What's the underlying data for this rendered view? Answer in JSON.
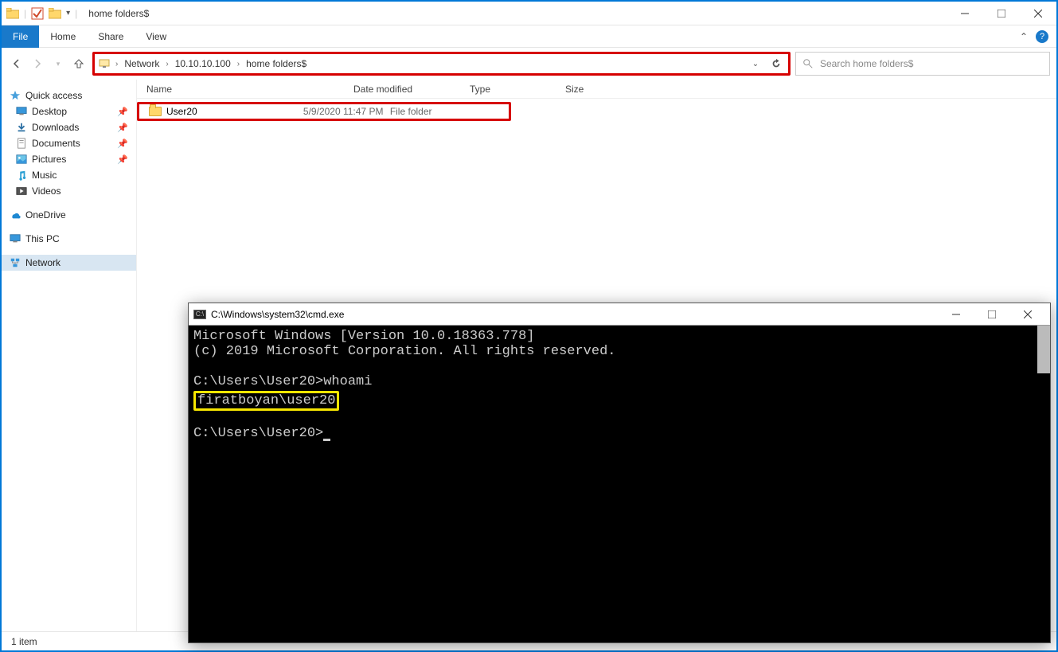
{
  "window": {
    "title": "home folders$",
    "minimize_tip": "Minimize",
    "maximize_tip": "Maximize",
    "close_tip": "Close"
  },
  "ribbon": {
    "file": "File",
    "tabs": [
      "Home",
      "Share",
      "View"
    ]
  },
  "breadcrumbs": [
    "Network",
    "10.10.10.100",
    "home folders$"
  ],
  "search": {
    "placeholder": "Search home folders$"
  },
  "sidebar": {
    "quick_access": "Quick access",
    "pinned": [
      {
        "label": "Desktop"
      },
      {
        "label": "Downloads"
      },
      {
        "label": "Documents"
      },
      {
        "label": "Pictures"
      },
      {
        "label": "Music"
      },
      {
        "label": "Videos"
      }
    ],
    "onedrive": "OneDrive",
    "this_pc": "This PC",
    "network": "Network"
  },
  "columns": {
    "name": "Name",
    "date": "Date modified",
    "type": "Type",
    "size": "Size"
  },
  "files": [
    {
      "name": "User20",
      "date": "5/9/2020 11:47 PM",
      "type": "File folder",
      "size": ""
    }
  ],
  "status": {
    "count": "1 item"
  },
  "cmd": {
    "title": "C:\\Windows\\system32\\cmd.exe",
    "line1": "Microsoft Windows [Version 10.0.18363.778]",
    "line2": "(c) 2019 Microsoft Corporation. All rights reserved.",
    "prompt1": "C:\\Users\\User20>whoami",
    "result1": "firatboyan\\user20",
    "prompt2": "C:\\Users\\User20>"
  }
}
